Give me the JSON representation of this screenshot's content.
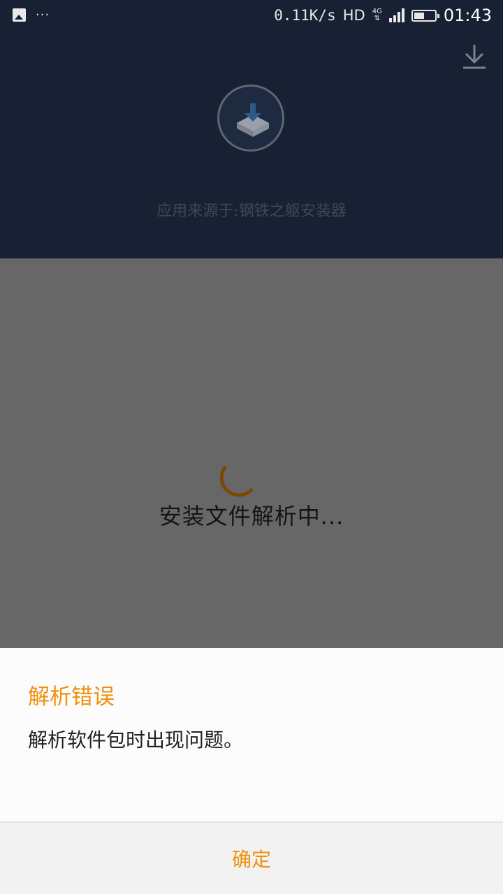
{
  "status_bar": {
    "speed": "0.11K/s",
    "hd": "HD",
    "network": "4G",
    "time": "01:43",
    "battery_level": 0.5,
    "icons": [
      "gallery-icon",
      "more-dots-icon",
      "signal-icon",
      "battery-icon"
    ]
  },
  "header": {
    "source_label": "应用来源于:钢铁之躯安装器",
    "icons": [
      "download-icon",
      "installer-app-icon"
    ]
  },
  "body": {
    "parsing_text": "安装文件解析中..."
  },
  "dialog": {
    "title": "解析错误",
    "message": "解析软件包时出现问题。",
    "confirm_label": "确定"
  },
  "colors": {
    "header_bg": "#172133",
    "dim_bg": "#676767",
    "accent": "#f0900c",
    "spinner": "#7a4a05"
  }
}
